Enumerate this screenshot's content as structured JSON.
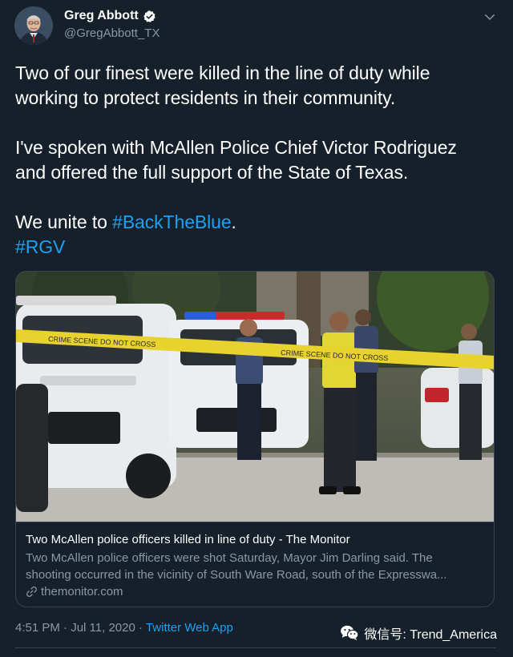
{
  "author": {
    "display_name": "Greg Abbott",
    "handle": "@GregAbbott_TX",
    "verified_icon": "verified-badge-icon",
    "menu_icon": "chevron-down-icon"
  },
  "tweet": {
    "line1": "Two of our finest were killed in the line of duty while",
    "line2": "working to protect residents in their community.",
    "line3": "I've spoken with McAllen Police Chief Victor Rodriguez",
    "line4": "and offered the full support of the State of Texas.",
    "line5_prefix": "We unite to ",
    "hashtag1": "#BackTheBlue",
    "line5_suffix": ".",
    "hashtag2": "#RGV"
  },
  "card": {
    "title": "Two McAllen police officers killed in line of duty - The Monitor",
    "description_line1": "Two McAllen police officers were shot Saturday, Mayor Jim Darling said. The",
    "description_line2": "shooting occurred in the vicinity of South Ware Road, south of the Expresswa...",
    "domain": "themonitor.com",
    "tape_text": "CRIME SCENE DO NOT CROSS"
  },
  "footer": {
    "time": "4:51 PM",
    "separator1": " · ",
    "date": "Jul 11, 2020",
    "separator2": " · ",
    "app": "Twitter Web App"
  },
  "watermark": {
    "text": "微信号: Trend_America"
  },
  "colors": {
    "background": "#15202b",
    "text": "#ffffff",
    "secondary": "#8899a6",
    "accent": "#1da1f2",
    "border": "#38444d"
  }
}
